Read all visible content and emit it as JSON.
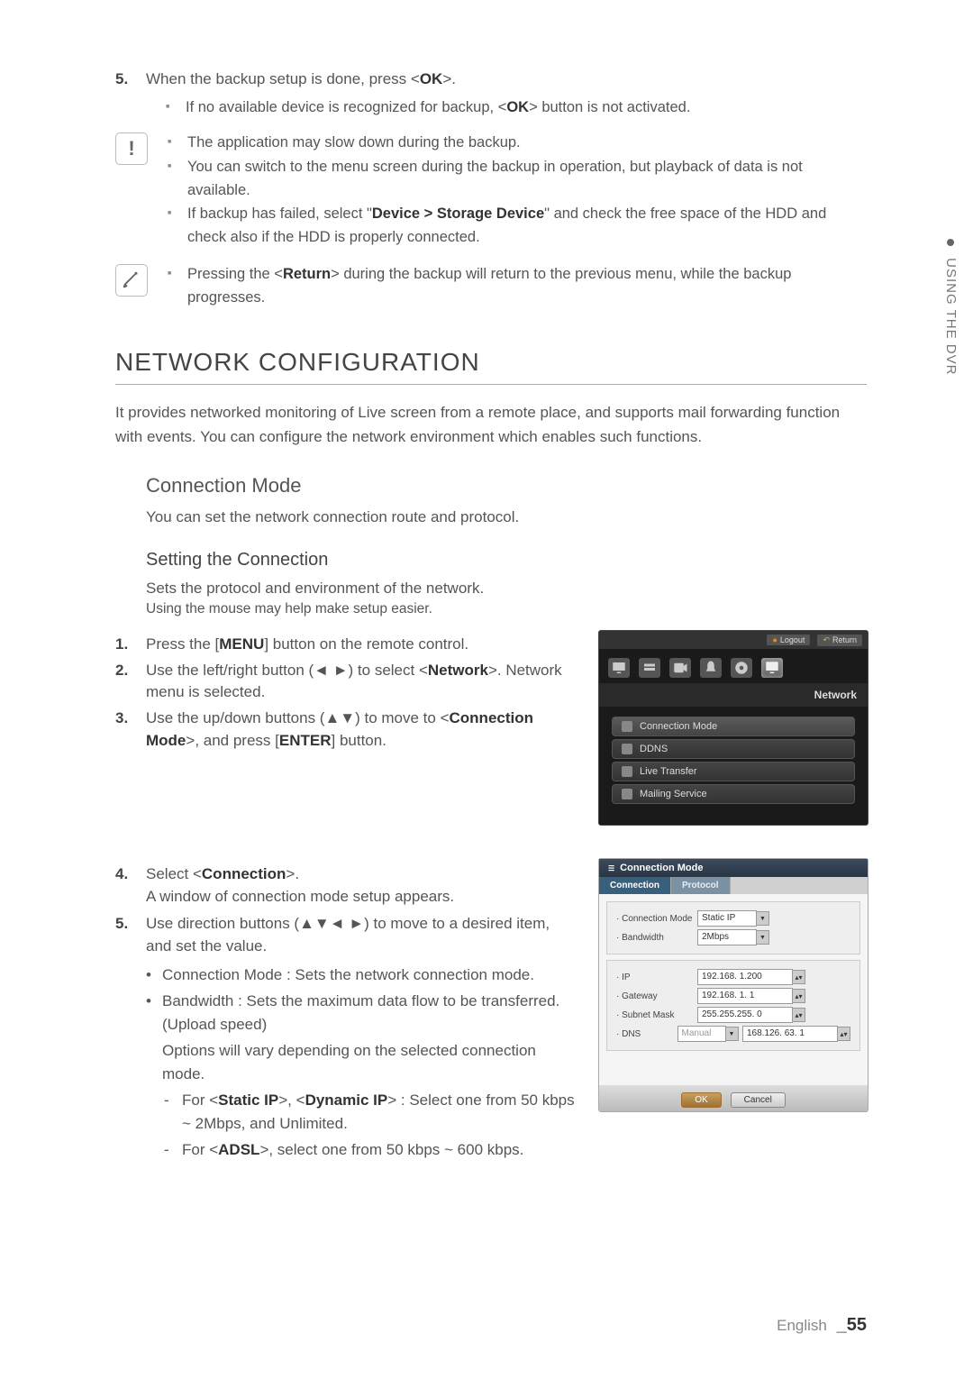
{
  "side_tab": {
    "label": "USING THE DVR"
  },
  "step5": {
    "num": "5.",
    "text_a": "When the backup setup is done, press <",
    "text_b": "OK",
    "text_c": ">."
  },
  "step5_sub1": {
    "text_a": "If no available device is recognized for backup, <",
    "text_b": "OK",
    "text_c": "> button is not activated."
  },
  "caution": {
    "l1": "The application may slow down during the backup.",
    "l2": "You can switch to the menu screen during the backup in operation, but playback of data is not available.",
    "l3_a": "If backup has failed, select \"",
    "l3_b": "Device > Storage Device",
    "l3_c": "\" and check the free space of the HDD and check also if the HDD is properly connected."
  },
  "note1": {
    "text_a": "Pressing the <",
    "text_b": "Return",
    "text_c": "> during the backup will return to the previous menu, while the backup progresses."
  },
  "section_h1": "NETWORK CONFIGURATION",
  "section_intro": "It provides networked monitoring of Live screen from a remote place, and supports mail forwarding function with events. You can configure the network environment which enables such functions.",
  "h2_conn": "Connection Mode",
  "conn_desc": "You can set the network connection route and protocol.",
  "h3_setting": "Setting the Connection",
  "setting_desc": "Sets the protocol and environment of the network.",
  "setting_tip": "Using the mouse may help make setup easier.",
  "s1": {
    "num": "1.",
    "a": "Press the [",
    "b": "MENU",
    "c": "] button on the remote control."
  },
  "s2": {
    "num": "2.",
    "a": "Use the left/right button (◄ ►) to select <",
    "b": "Network",
    "c": ">. Network menu is selected."
  },
  "s3": {
    "num": "3.",
    "a": "Use the up/down buttons (▲▼) to move to <",
    "b": "Connection Mode",
    "c": ">, and press [",
    "d": "ENTER",
    "e": "] button."
  },
  "s4": {
    "num": "4.",
    "a": "Select <",
    "b": "Connection",
    "c": ">.",
    "d": "A window of connection mode setup appears."
  },
  "s5": {
    "num": "5.",
    "a": "Use direction buttons (▲▼◄ ►) to move to a desired item, and set the value."
  },
  "b1": "Connection Mode : Sets the network connection mode.",
  "b2": "Bandwidth : Sets the maximum data flow to be transferred. (Upload speed)",
  "b2_cont": "Options will vary depending on the selected connection mode.",
  "d1": {
    "a": "For <",
    "b": "Static IP",
    "c": ">, <",
    "d": "Dynamic IP",
    "e": "> : Select one from 50 kbps ~ 2Mbps, and Unlimited."
  },
  "d2": {
    "a": "For <",
    "b": "ADSL",
    "c": ">, select one from 50 kbps ~ 600 kbps."
  },
  "dvr1": {
    "logout": "Logout",
    "return": "Return",
    "header": "Network",
    "items": [
      "Connection Mode",
      "DDNS",
      "Live Transfer",
      "Mailing Service"
    ]
  },
  "dvr2": {
    "title": "Connection Mode",
    "tab1": "Connection",
    "tab2": "Protocol",
    "rows": {
      "conn_mode": {
        "lbl": "Connection Mode",
        "val": "Static IP"
      },
      "bandwidth": {
        "lbl": "Bandwidth",
        "val": "2Mbps"
      },
      "ip": {
        "lbl": "IP",
        "val": "192.168.  1.200"
      },
      "gateway": {
        "lbl": "Gateway",
        "val": "192.168.  1.    1"
      },
      "subnet": {
        "lbl": "Subnet Mask",
        "val": "255.255.255.  0"
      },
      "dns": {
        "lbl": "DNS",
        "sel": "Manual",
        "val": "168.126. 63.   1"
      }
    },
    "ok": "OK",
    "cancel": "Cancel"
  },
  "footer": {
    "lang": "English",
    "page": "_55"
  }
}
